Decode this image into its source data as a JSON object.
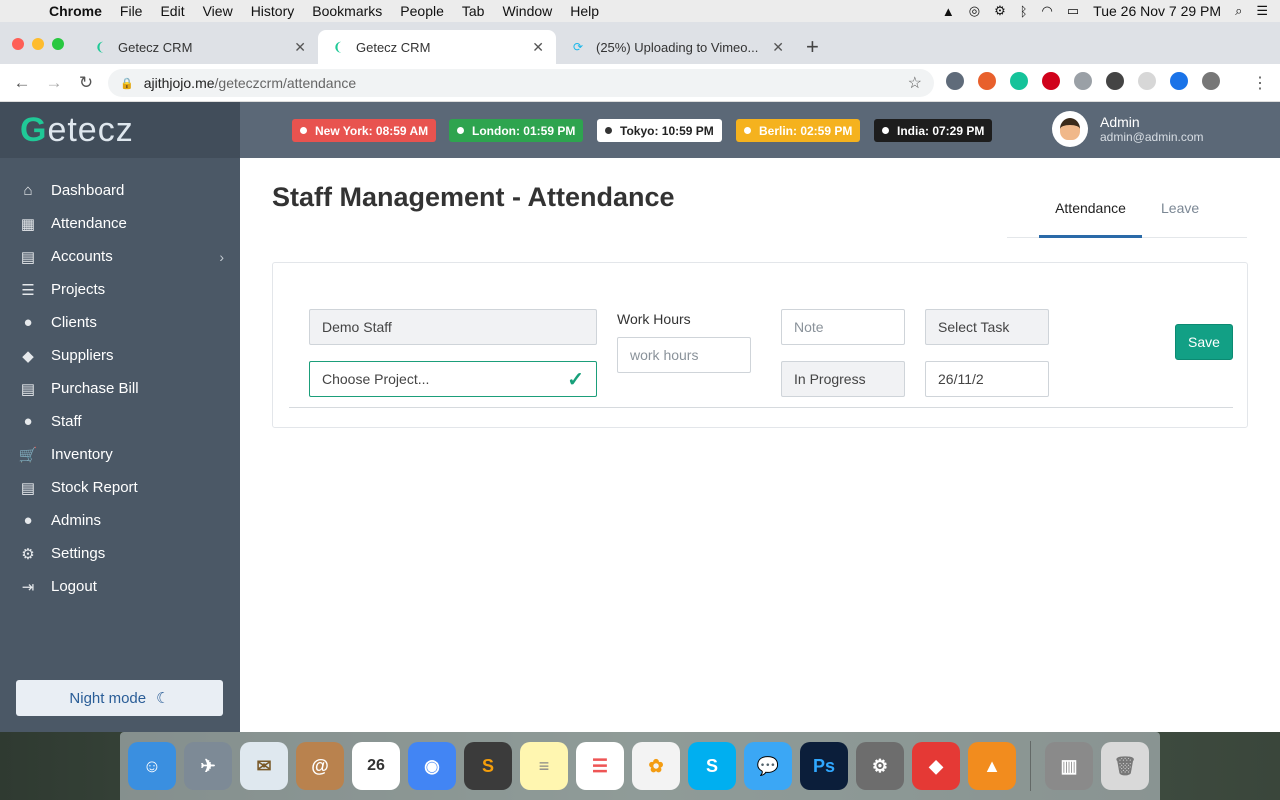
{
  "menubar": {
    "app": "Chrome",
    "items": [
      "File",
      "Edit",
      "View",
      "History",
      "Bookmarks",
      "People",
      "Tab",
      "Window",
      "Help"
    ],
    "clock": "Tue 26 Nov  7 29 PM"
  },
  "browser": {
    "tabs": [
      {
        "title": "Getecz CRM"
      },
      {
        "title": "Getecz CRM"
      },
      {
        "title": "(25%) Uploading to Vimeo..."
      }
    ],
    "url_domain": "ajithjojo.me",
    "url_path": "/geteczcrm/attendance"
  },
  "brand": {
    "logo_first": "G",
    "logo_rest": "etecz"
  },
  "sidebar": {
    "items": [
      {
        "label": "Dashboard",
        "icon": "home-icon"
      },
      {
        "label": "Attendance",
        "icon": "calendar-icon"
      },
      {
        "label": "Accounts",
        "icon": "briefcase-icon"
      },
      {
        "label": "Projects",
        "icon": "list-icon"
      },
      {
        "label": "Clients",
        "icon": "user-icon"
      },
      {
        "label": "Suppliers",
        "icon": "tags-icon"
      },
      {
        "label": "Purchase Bill",
        "icon": "list-alt-icon"
      },
      {
        "label": "Staff",
        "icon": "user-icon"
      },
      {
        "label": "Inventory",
        "icon": "cart-icon"
      },
      {
        "label": "Stock Report",
        "icon": "list-alt-icon"
      },
      {
        "label": "Admins",
        "icon": "user-icon"
      },
      {
        "label": "Settings",
        "icon": "gear-icon"
      },
      {
        "label": "Logout",
        "icon": "logout-icon"
      }
    ],
    "night_mode": "Night mode"
  },
  "clocks": [
    {
      "label": "New York: 08:59 AM",
      "bg": "#e8534f",
      "fg": "#ffffff",
      "dot": "#ffffff"
    },
    {
      "label": "London: 01:59 PM",
      "bg": "#2ea44f",
      "fg": "#ffffff",
      "dot": "#ffffff"
    },
    {
      "label": "Tokyo: 10:59 PM",
      "bg": "#ffffff",
      "fg": "#222222",
      "dot": "#333333"
    },
    {
      "label": "Berlin: 02:59 PM",
      "bg": "#f5b21e",
      "fg": "#ffffff",
      "dot": "#ffffff"
    },
    {
      "label": "India: 07:29 PM",
      "bg": "#1d1d1d",
      "fg": "#ffffff",
      "dot": "#ffffff"
    }
  ],
  "user": {
    "name": "Admin",
    "email": "admin@admin.com"
  },
  "page": {
    "title": "Staff Management - Attendance",
    "tabs": {
      "active": "Attendance",
      "inactive": "Leave"
    }
  },
  "form": {
    "staff_value": "Demo Staff",
    "project_value": "Choose Project...",
    "work_hours_label": "Work Hours",
    "work_hours_placeholder": "work hours",
    "note_placeholder": "Note",
    "status_value": "In Progress",
    "task_value": "Select Task",
    "date_value": "26/11/2",
    "save_label": "Save"
  },
  "colors": {
    "accent": "#12a085",
    "sidebar": "#4b5866",
    "header": "#5b6877"
  }
}
